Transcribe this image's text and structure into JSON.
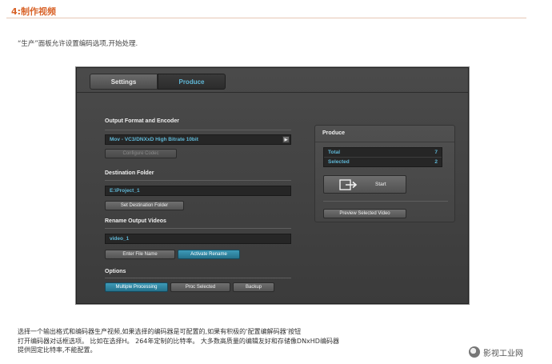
{
  "page": {
    "section_title": "4:制作视频",
    "intro": "“生产”面板允许设置编码选项,开始处理.",
    "caption_lines": [
      "选择一个输出格式和编码器生产视频,如果选择的编码器是可配置的,如果有积极的‘配置编解码器’按钮",
      "打开编码器对话框选项。 比如在选择H。 264年定制的比特率。 大多数高质量的编辑友好和存储像DNxHD编码器",
      "提供固定比特率,不能配置。"
    ],
    "watermark": "影视工业网"
  },
  "app": {
    "tabs": [
      {
        "label": "Settings",
        "active": false
      },
      {
        "label": "Produce",
        "active": true
      }
    ],
    "output_format": {
      "label": "Output Format and Encoder",
      "value": "Mov - VC3/DNXxD High Bitrate 10bit",
      "configure_button": "Configure Codec"
    },
    "destination": {
      "label": "Destination Folder",
      "value": "E:\\Project_1",
      "set_button": "Set Destination Folder"
    },
    "rename": {
      "label": "Rename Output Videos",
      "value": "video_1",
      "enter_button": "Enter File Name",
      "activate_button": "Activate Rename"
    },
    "options": {
      "label": "Options",
      "buttons": [
        "Multiple Processing",
        "Proc Selected",
        "Backup"
      ]
    },
    "produce_panel": {
      "title": "Produce",
      "total_label": "Total",
      "total_value": "7",
      "selected_label": "Selected",
      "selected_value": "2",
      "start_label": "Start",
      "preview_button": "Preview Selected Video"
    }
  },
  "colors": {
    "accent_blue": "#5fb7d6",
    "title_orange": "#d9642a",
    "app_bg": "#444444"
  }
}
